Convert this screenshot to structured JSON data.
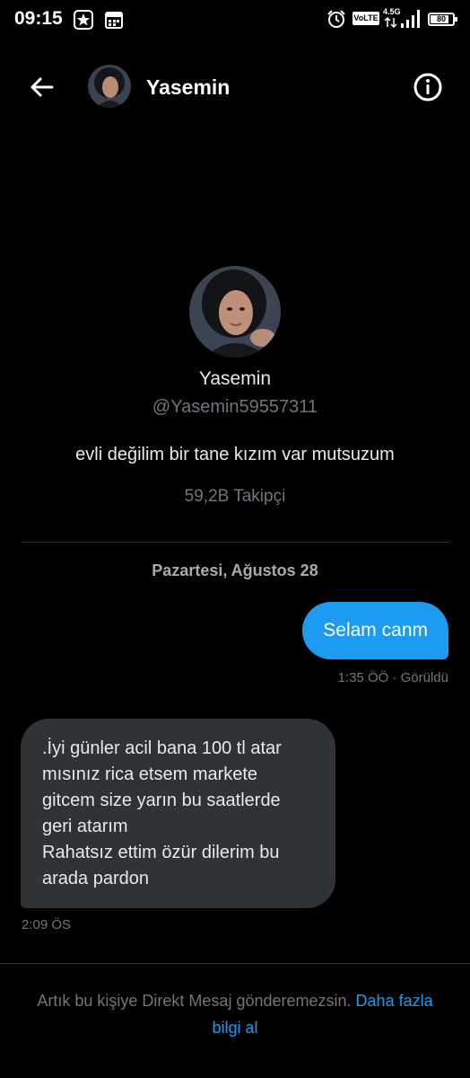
{
  "status_bar": {
    "time": "09:15",
    "volte": "VoLTE",
    "network": "4.5G",
    "battery": "80",
    "icons": [
      "app-star-icon",
      "calendar-icon",
      "alarm-icon",
      "volte-icon",
      "network-icon",
      "signal-icon",
      "battery-icon"
    ]
  },
  "header": {
    "name": "Yasemin",
    "icons": [
      "back-arrow-icon",
      "info-icon"
    ]
  },
  "profile": {
    "name": "Yasemin",
    "handle": "@Yasemin59557311",
    "bio": "evli değilim bir tane kızım var mutsuzum",
    "followers": "59,2B Takipçi"
  },
  "conversation": {
    "date": "Pazartesi, Ağustos 28",
    "outgoing": {
      "text": "Selam canm",
      "meta": "1:35 ÖÖ · Görüldü"
    },
    "incoming": {
      "lines": [
        ".İyi günler acil bana 100 tl atar",
        "mısınız rica etsem  markete",
        "gitcem size yarın bu saatlerde",
        "geri atarım",
        "Rahatsız ettim özür dilerim  bu",
        "arada pardon"
      ],
      "meta": "2:09 ÖS"
    }
  },
  "footer": {
    "notice": "Artık bu kişiye Direkt Mesaj gönderemezsin.",
    "link": "Daha fazla bilgi al"
  },
  "colors": {
    "background": "#000000",
    "accent": "#1d9bf0",
    "incoming_bubble": "#2f3336",
    "muted_text": "#71767b"
  }
}
